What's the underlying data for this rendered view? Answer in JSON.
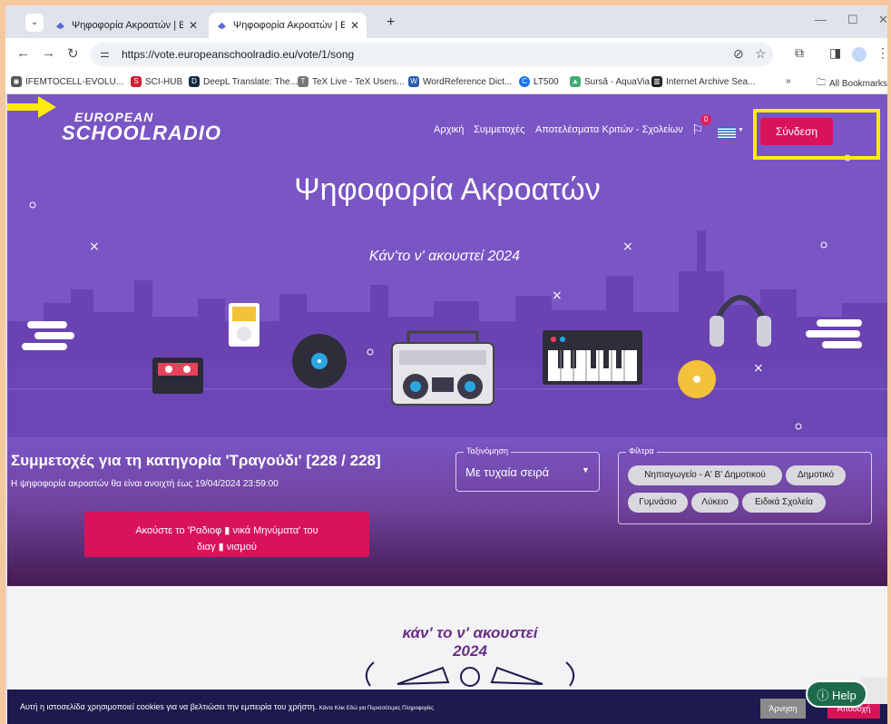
{
  "browser": {
    "tabs": [
      {
        "title": "Ψηφοφορία Ακροατών | Europ",
        "active": false
      },
      {
        "title": "Ψηφοφορία Ακροατών | Europ",
        "active": true
      }
    ],
    "new_tab": "+",
    "url": "https://vote.europeanschoolradio.eu/vote/1/song",
    "bookmarks": [
      "IFEMTOCELL-EVOLU...",
      "SCI-HUB",
      "DeepL Translate: The...",
      "TeX Live - TeX Users...",
      "WordReference Dict...",
      "LT500",
      "Sursă - AquaVia",
      "Internet Archive Sea..."
    ],
    "bookmarks_more": "»",
    "all_bookmarks": "All Bookmarks"
  },
  "site": {
    "logo_line1": "EUROPEAN",
    "logo_line2": "SCHOOLRADIO",
    "nav": [
      "Αρχική",
      "Συμμετοχές",
      "Αποτελέσματα Κριτών - Σχολείων"
    ],
    "notif_count": "0",
    "login": "Σύνδεση",
    "title": "Ψηφοφορία Ακροατών",
    "subtitle": "Κάν'το ν' ακουστεί 2024"
  },
  "controls": {
    "category_title": "Συμμετοχές για τη κατηγορία 'Τραγούδι' [228 / 228]",
    "vote_note": "Η ψηφοφορία ακροατών θα είναι ανοιχτή έως 19/04/2024 23:59:00",
    "listen_button_line1": "Ακούστε το 'Ραδιοφ ▮ νικά Μηνύματα' του",
    "listen_button_line2": "διαγ ▮ νισμού",
    "sort_label": "Ταξινόμηση",
    "sort_value": "Με τυχαία σειρά",
    "filters_label": "Φίλτρα",
    "filters": [
      "Νηπιαγωγείο - Α' Β' Δημοτικού",
      "Δημοτικό",
      "Γυμνάσιο",
      "Λύκειο",
      "Ειδικά Σχολεία"
    ]
  },
  "lower": {
    "logo_line1": "κάν' το ν' ακουστεί",
    "logo_line2": "2024"
  },
  "cookie": {
    "text": "Αυτή η ιστοσελίδα χρησιμοποιεί cookies για να βελτιώσει την εμπειρία του χρήστη.",
    "more": "Κάντε Κλικ Εδώ για Περισσότερες Πληροφορίες",
    "deny": "Άρνηση",
    "accept": "Αποδοχή"
  },
  "help": "Help",
  "colors": {
    "hero": "#7a55c4",
    "accent": "#d9135a",
    "highlight": "#ffeb0a",
    "cookie_bar": "#1c1a4e"
  }
}
